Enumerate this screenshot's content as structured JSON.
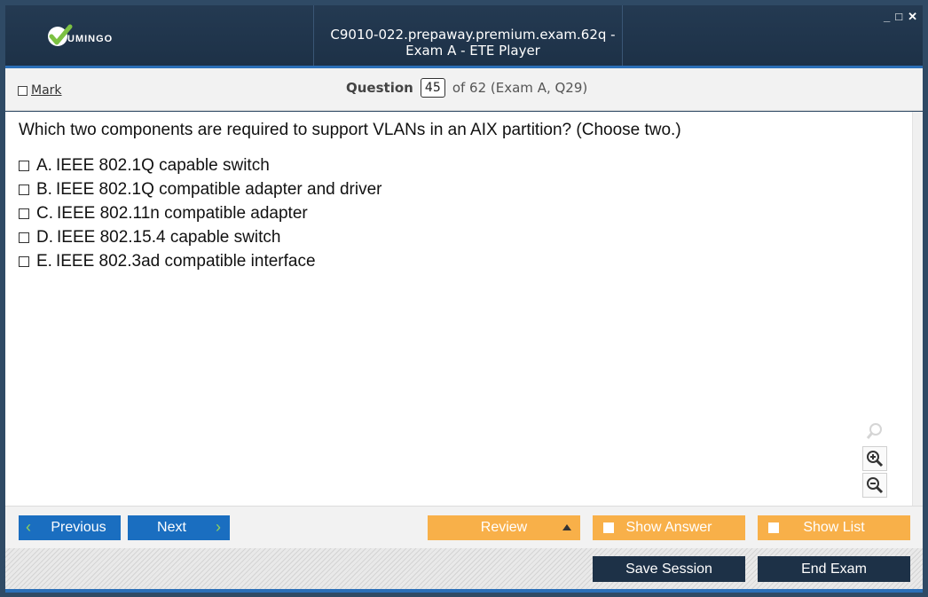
{
  "window": {
    "title": "C9010-022.prepaway.premium.exam.62q - Exam A - ETE Player",
    "logo_text": "UMINGO",
    "controls": [
      "_",
      "□",
      "✕"
    ]
  },
  "header": {
    "mark_label": "Mark",
    "question_label": "Question",
    "question_number": "45",
    "question_of": "of 62 (Exam A, Q29)"
  },
  "question": {
    "text": "Which two components are required to support VLANs in an AIX partition? (Choose two.)",
    "options": [
      {
        "letter": "A.",
        "text": "IEEE 802.1Q capable switch"
      },
      {
        "letter": "B.",
        "text": "IEEE 802.1Q compatible adapter and driver"
      },
      {
        "letter": "C.",
        "text": "IEEE 802.11n compatible adapter"
      },
      {
        "letter": "D.",
        "text": "IEEE 802.15.4 capable switch"
      },
      {
        "letter": "E.",
        "text": "IEEE 802.3ad compatible interface"
      }
    ]
  },
  "nav": {
    "previous_label": "Previous",
    "next_label": "Next",
    "review_label": "Review",
    "show_answer_label": "Show Answer",
    "show_list_label": "Show List"
  },
  "footer": {
    "save_session_label": "Save Session",
    "end_exam_label": "End Exam"
  },
  "icons": {
    "logo": "checkmark-logo-icon",
    "zoom_reset": "magnifier-icon",
    "zoom_in": "zoom-in-icon",
    "zoom_out": "zoom-out-icon",
    "prev": "chevron-left-icon",
    "next": "chevron-right-icon",
    "review_menu": "triangle-up-icon"
  },
  "colors": {
    "title_bg": "#1d3147",
    "accent_blue": "#1a6ec0",
    "accent_orange": "#f8b049",
    "chevron_green": "#8fd15c",
    "dark_button": "#1d3147"
  }
}
